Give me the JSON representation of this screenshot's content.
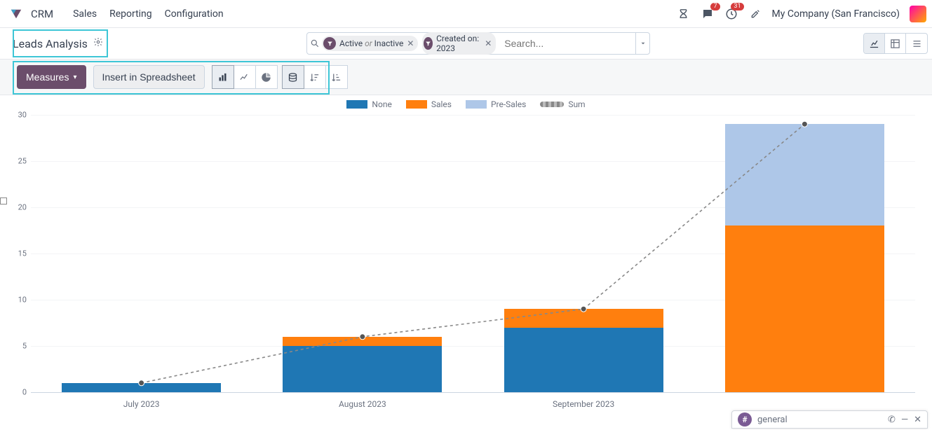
{
  "nav": {
    "app": "CRM",
    "items": [
      "Sales",
      "Reporting",
      "Configuration"
    ],
    "badges": {
      "messages": "7",
      "activities": "31"
    },
    "company": "My Company (San Francisco)"
  },
  "breadcrumb": {
    "title": "Leads Analysis"
  },
  "search": {
    "facet1": {
      "a": "Active",
      "or": "or",
      "b": "Inactive"
    },
    "facet2": "Created on: 2023",
    "placeholder": "Search..."
  },
  "toolbar": {
    "measures": "Measures",
    "spreadsheet": "Insert in Spreadsheet"
  },
  "legend": {
    "none": "None",
    "sales": "Sales",
    "presales": "Pre-Sales",
    "sum": "Sum"
  },
  "chat": {
    "channel": "general"
  },
  "chart_data": {
    "type": "bar",
    "stacked": true,
    "categories": [
      "July 2023",
      "August 2023",
      "September 2023",
      ""
    ],
    "series": [
      {
        "name": "None",
        "values": [
          1,
          5,
          7,
          0
        ]
      },
      {
        "name": "Sales",
        "values": [
          0,
          1,
          2,
          18
        ]
      },
      {
        "name": "Pre-Sales",
        "values": [
          0,
          0,
          0,
          11
        ]
      }
    ],
    "sum": [
      1,
      6,
      9,
      29
    ],
    "ylim": [
      0,
      30
    ],
    "yticks": [
      0,
      5,
      10,
      15,
      20,
      25,
      30
    ],
    "title": "",
    "xlabel": "",
    "ylabel": ""
  }
}
